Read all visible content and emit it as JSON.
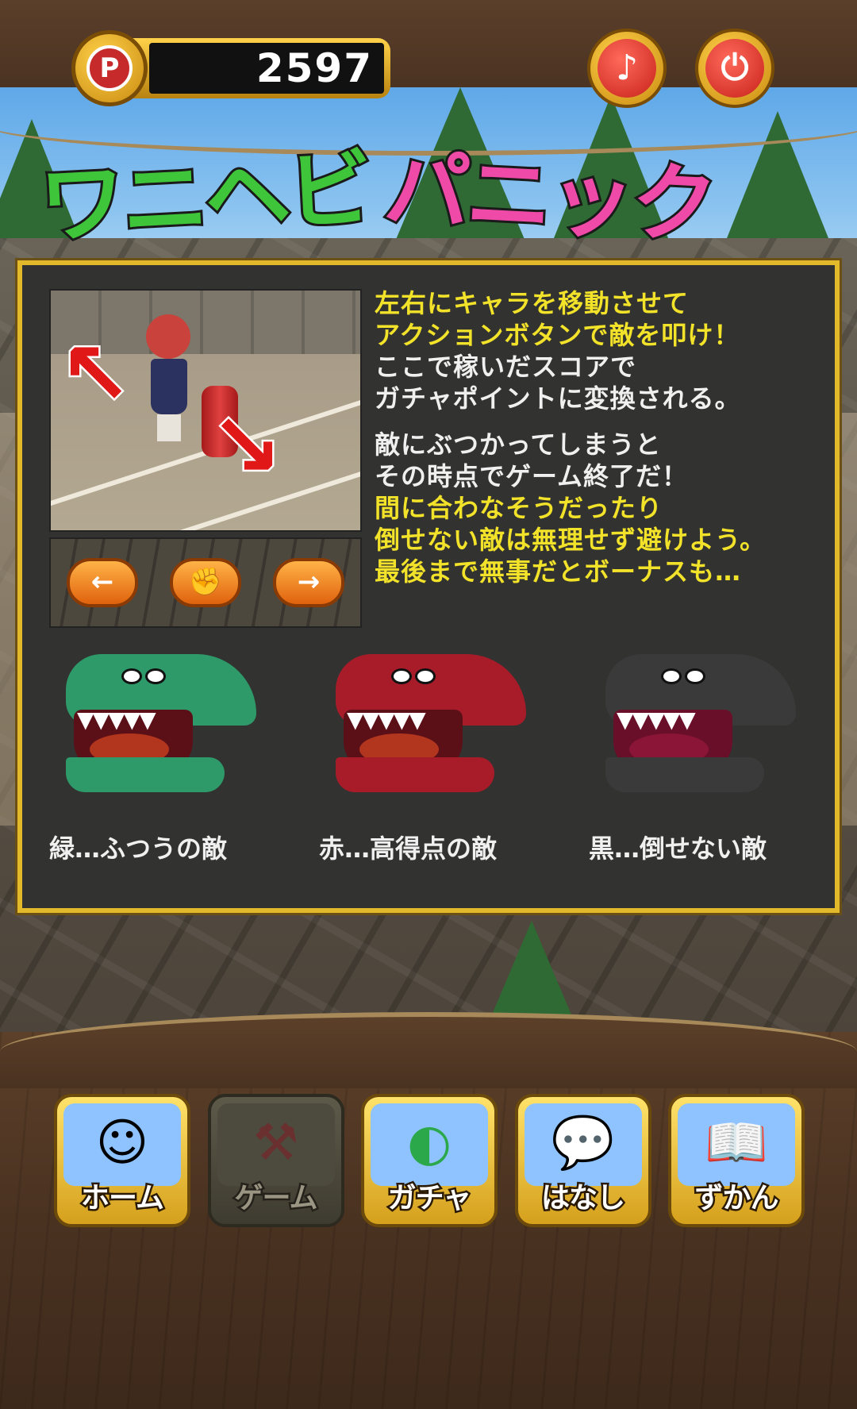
{
  "header": {
    "points_icon": "P",
    "points_value": "2597",
    "music_icon": "♪",
    "power_icon": "⏻"
  },
  "logo": {
    "part1": "ワニヘビ",
    "part2": "パニック"
  },
  "instructions": {
    "lines_1": [
      {
        "text": "左右にキャラを移動させて",
        "color": "yellow"
      },
      {
        "text": "アクションボタンで敵を叩け！",
        "color": "yellow"
      },
      {
        "text": "ここで稼いだスコアで",
        "color": "white"
      },
      {
        "text": "ガチャポイントに変換される。",
        "color": "white"
      }
    ],
    "lines_2": [
      {
        "text": "敵にぶつかってしまうと",
        "color": "white"
      },
      {
        "text": "その時点でゲーム終了だ！",
        "color": "white"
      },
      {
        "text": "間に合わなそうだったり",
        "color": "yellow"
      },
      {
        "text": "倒せない敵は無理せず避けよう。",
        "color": "yellow"
      },
      {
        "text": "最後まで無事だとボーナスも…",
        "color": "yellow"
      }
    ],
    "controls": {
      "left_icon": "left-arrow-icon",
      "action_icon": "hammer-icon",
      "right_icon": "right-arrow-icon"
    }
  },
  "enemies": [
    {
      "label": "緑…ふつうの敵",
      "color": "#2e9a6a"
    },
    {
      "label": "赤…高得点の敵",
      "color": "#a81c2a"
    },
    {
      "label": "黒…倒せない敵",
      "color": "#3a3a3a"
    }
  ],
  "nav": [
    {
      "label": "ホーム",
      "icon": "character-icon",
      "enabled": true
    },
    {
      "label": "ゲーム",
      "icon": "hammer-icon",
      "enabled": false
    },
    {
      "label": "ガチャ",
      "icon": "capsule-icon",
      "enabled": true
    },
    {
      "label": "はなし",
      "icon": "speech-bubble-icon",
      "enabled": true
    },
    {
      "label": "ずかん",
      "icon": "book-icon",
      "enabled": true
    }
  ],
  "colors": {
    "accent_gold": "#e1b92a",
    "text_yellow": "#f2e32a",
    "button_red": "#c7211b"
  }
}
